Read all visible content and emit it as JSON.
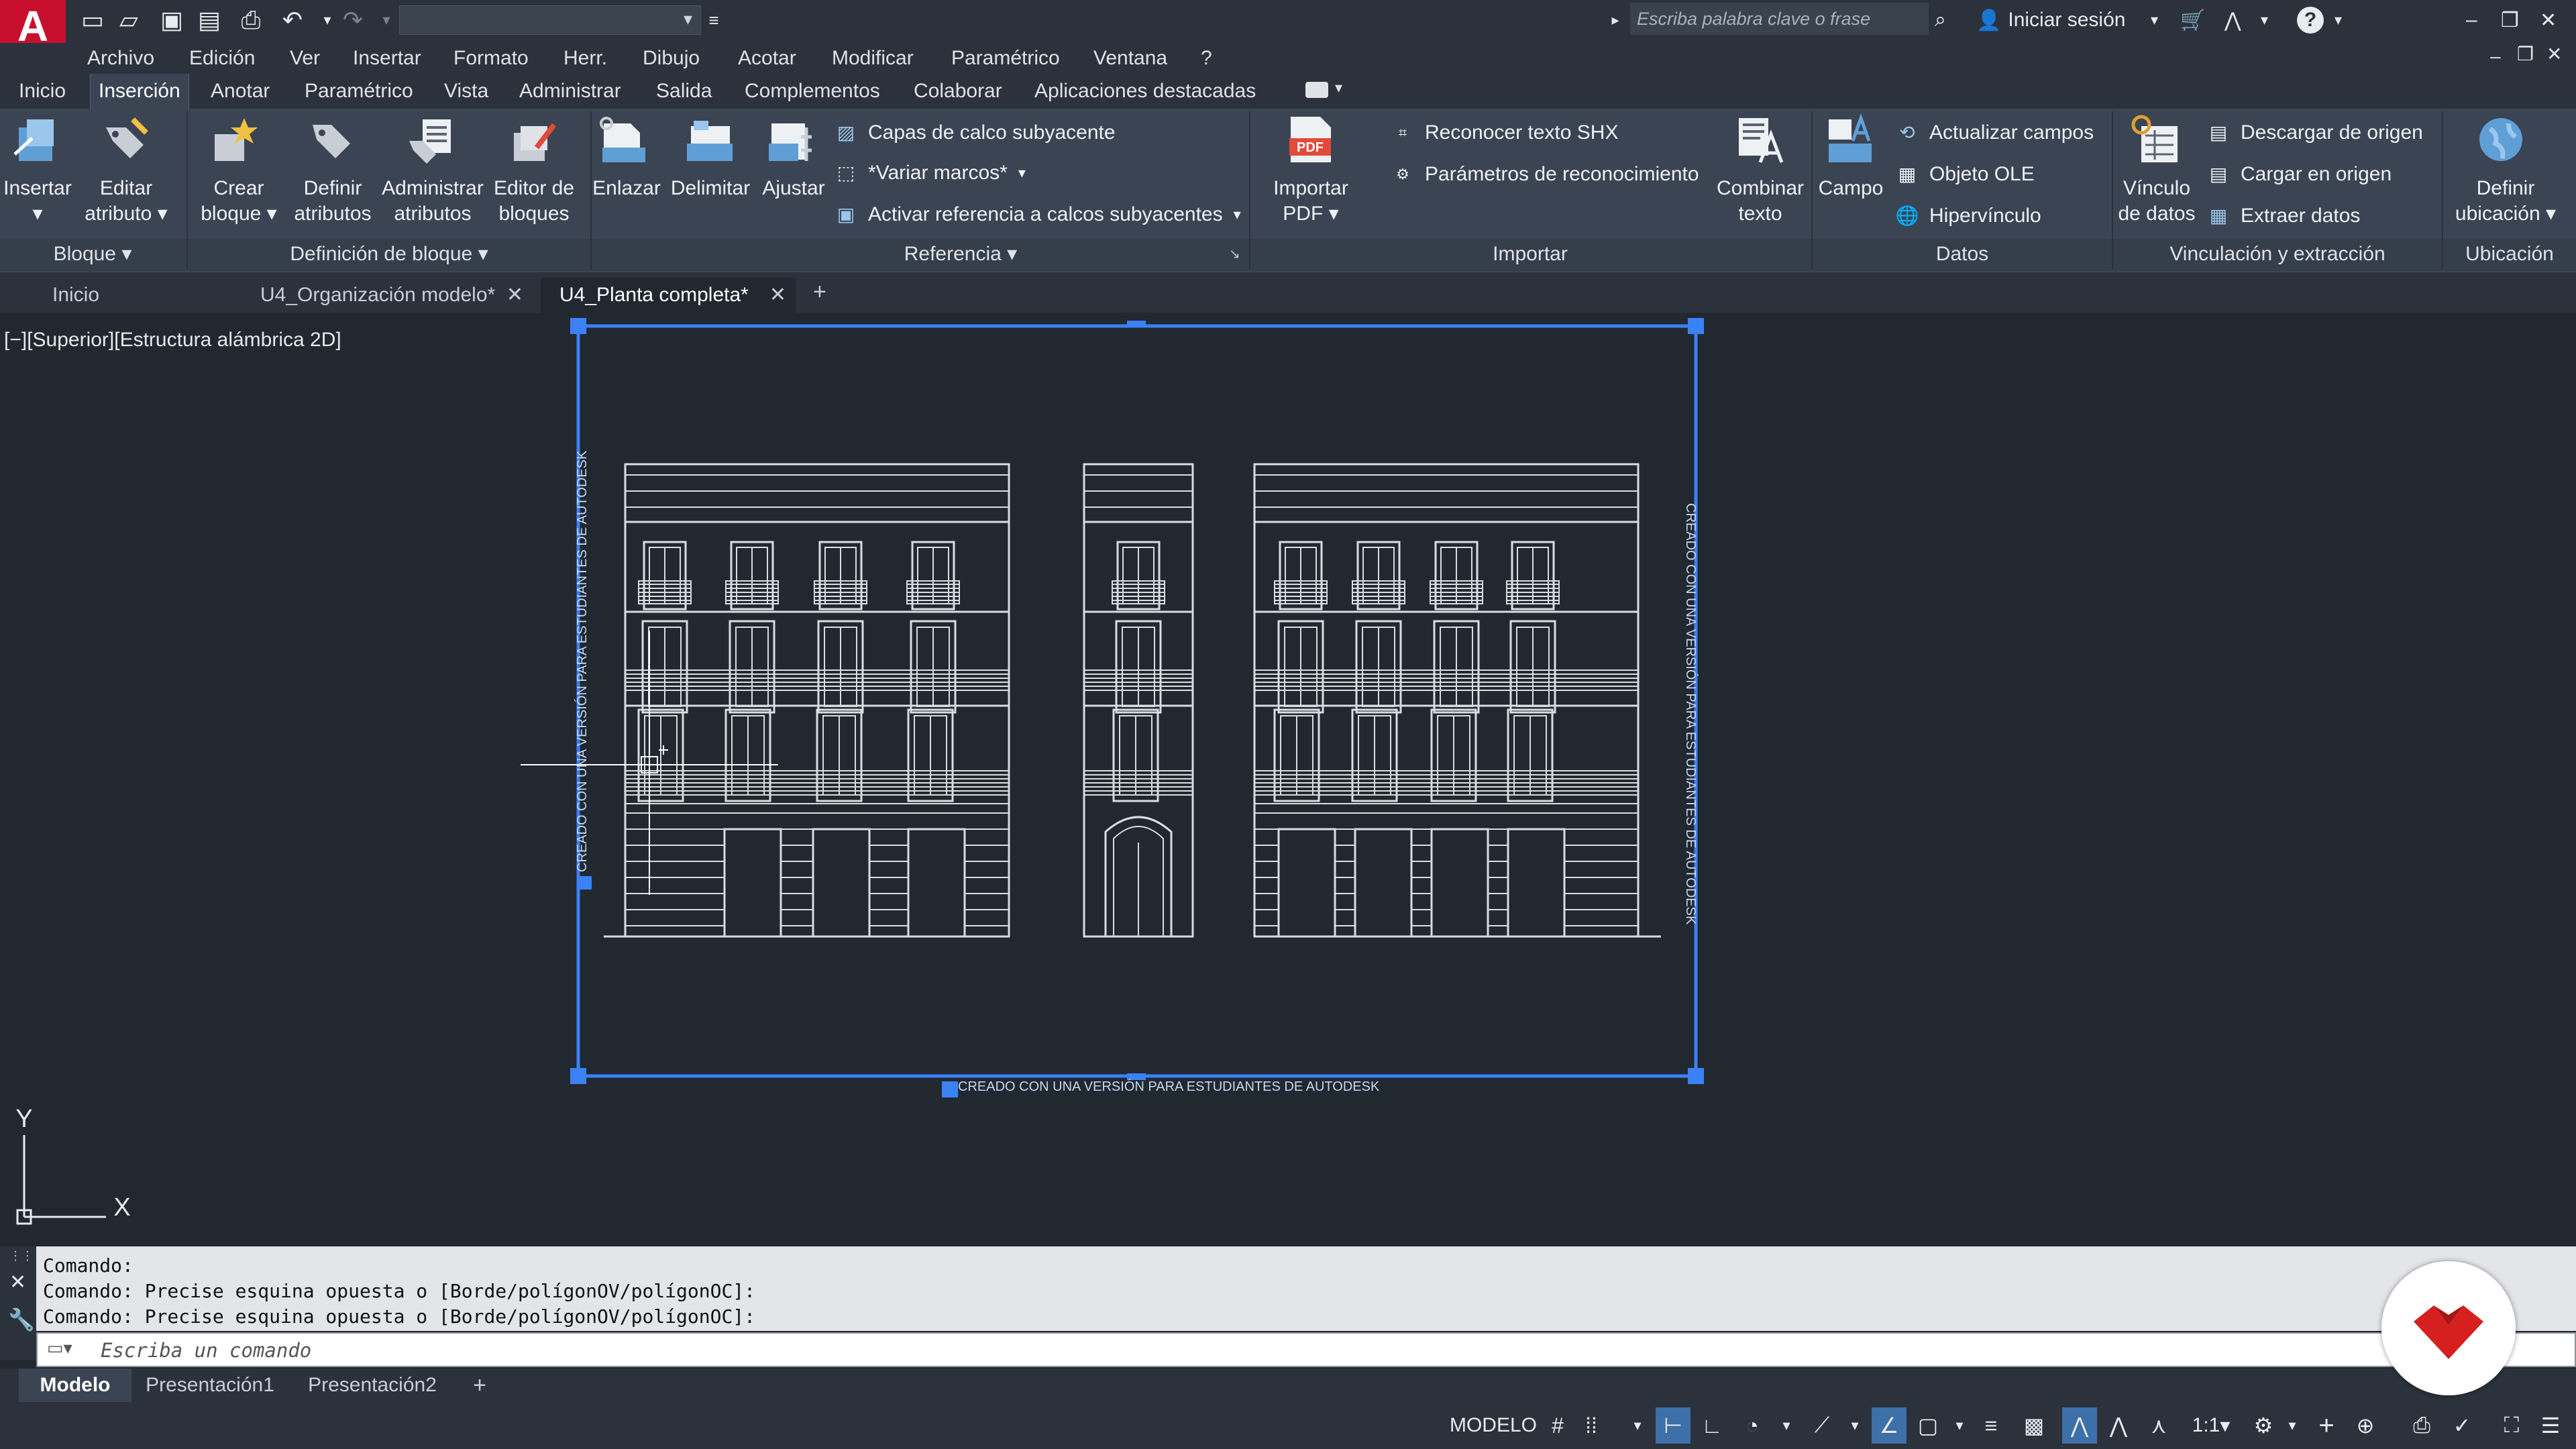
{
  "titlebar": {
    "logo_letter": "A",
    "search_placeholder": "Escriba palabra clave o frase",
    "sign_in": "Iniciar sesión",
    "help": "?"
  },
  "menu": [
    "Archivo",
    "Edición",
    "Ver",
    "Insertar",
    "Formato",
    "Herr.",
    "Dibujo",
    "Acotar",
    "Modificar",
    "Paramétrico",
    "Ventana",
    "?"
  ],
  "ribbon_tabs": [
    "Inicio",
    "Inserción",
    "Anotar",
    "Paramétrico",
    "Vista",
    "Administrar",
    "Salida",
    "Complementos",
    "Colaborar",
    "Aplicaciones destacadas"
  ],
  "ribbon_active_tab": "Inserción",
  "ribbon": {
    "bloque": {
      "title": "Bloque",
      "insertar": "Insertar",
      "editar_atributo_1": "Editar",
      "editar_atributo_2": "atributo"
    },
    "definicion": {
      "title": "Definición de bloque",
      "crear_1": "Crear",
      "crear_2": "bloque",
      "definir_1": "Definir",
      "definir_2": "atributos",
      "admin_1": "Administrar",
      "admin_2": "atributos",
      "editor_1": "Editor de",
      "editor_2": "bloques"
    },
    "referencia": {
      "title": "Referencia",
      "enlazar": "Enlazar",
      "delimitar": "Delimitar",
      "ajustar": "Ajustar",
      "capas": "Capas de calco subyacente",
      "variar": "*Variar marcos*",
      "activar": "Activar referencia a calcos subyacentes"
    },
    "importar": {
      "title": "Importar",
      "pdf_1": "Importar",
      "pdf_2": "PDF",
      "pdf_icon": "PDF",
      "reconocer": "Reconocer texto SHX",
      "parametros": "Parámetros de reconocimiento",
      "combinar_1": "Combinar",
      "combinar_2": "texto"
    },
    "datos": {
      "title": "Datos",
      "campo": "Campo",
      "actualizar": "Actualizar campos",
      "ole": "Objeto OLE",
      "hipervinculo": "Hipervínculo"
    },
    "vinculacion": {
      "title": "Vinculación y extracción",
      "vinculo_1": "Vínculo",
      "vinculo_2": "de datos",
      "descargar": "Descargar de origen",
      "cargar": "Cargar en origen",
      "extraer": "Extraer  datos"
    },
    "ubicacion": {
      "title": "Ubicación",
      "definir_1": "Definir",
      "definir_2": "ubicación"
    }
  },
  "doc_tabs": [
    {
      "label": "Inicio",
      "closable": false
    },
    {
      "label": "U4_Organización modelo*",
      "closable": true
    },
    {
      "label": "U4_Planta completa*",
      "closable": true,
      "active": true
    }
  ],
  "viewport_label": "[−][Superior][Estructura alámbrica 2D]",
  "watermark": "CREADO CON UNA VERSIÓN PARA ESTUDIANTES DE AUTODESK",
  "ucs": {
    "x": "X",
    "y": "Y"
  },
  "command": {
    "history": [
      "Comando:",
      "Comando: Precise esquina opuesta o [Borde/polígonOV/polígonOC]:",
      "Comando: Precise esquina opuesta o [Borde/polígonOV/polígonOC]:"
    ],
    "placeholder": "Escriba un comando"
  },
  "layout_tabs": [
    "Modelo",
    "Presentación1",
    "Presentación2"
  ],
  "status": {
    "mode": "MODELO",
    "scale": "1:1"
  },
  "colors": {
    "accent": "#3d6fa8",
    "logo": "#c8102e",
    "viewport_frame": "#3b82f6",
    "badge_logo": "#d61f1f"
  }
}
